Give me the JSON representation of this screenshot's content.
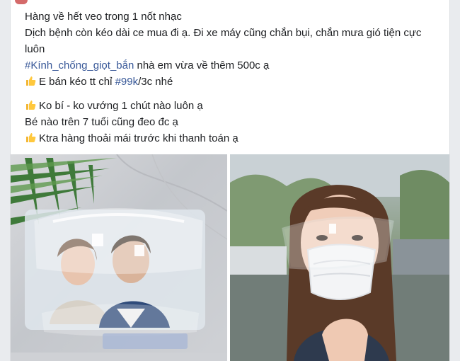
{
  "post": {
    "lines": [
      "Hàng về hết veo trong 1 nốt nhạc",
      "Dịch bệnh còn kéo dài ce mua đi ạ. Đi xe máy cũng chắn bụi, chắn mưa gió tiện cực luôn",
      "nhà em vừa về thêm 500c ạ",
      "E bán kéo tt chỉ",
      "/3c nhé",
      "Ko bí - ko vướng 1 chút nào luôn ạ",
      "Bé nào trên 7 tuổi cũng đeo đc ạ",
      "Ktra hàng thoải mái trước khi thanh toán ạ"
    ],
    "hashtag_product": "#Kính_chống_giọt_bắn",
    "hashtag_price": "#99k",
    "emoji_icon": "thumbs-up-icon"
  },
  "photos": {
    "left": {
      "alt": "product-photo-face-shield-glasses"
    },
    "right": {
      "alt": "product-photo-woman-wearing-shield-and-mask"
    }
  },
  "colors": {
    "hashtag": "#385898",
    "text": "#1c1e21",
    "background": "#e9ebee"
  }
}
